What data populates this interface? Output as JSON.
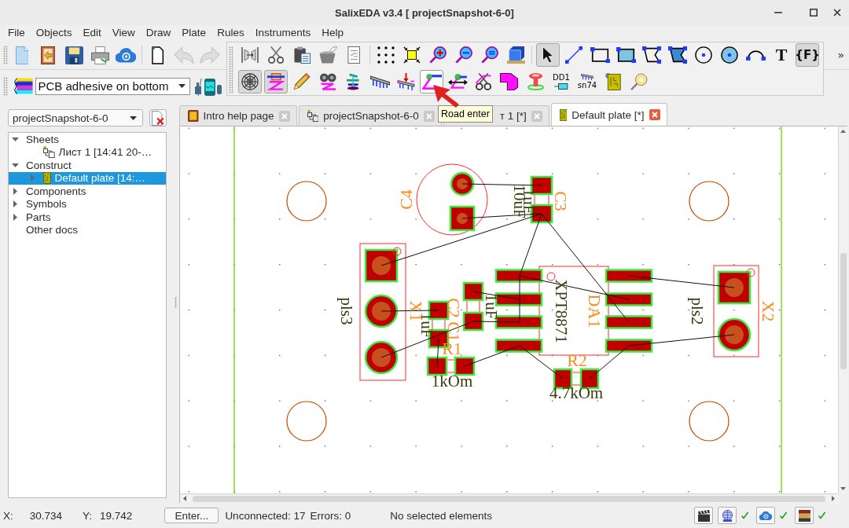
{
  "window": {
    "title": "SalixEDA v3.4 [ projectSnapshot-6-0]"
  },
  "menu": [
    "File",
    "Objects",
    "Edit",
    "View",
    "Draw",
    "Plate",
    "Rules",
    "Instruments",
    "Help"
  ],
  "main_toolbar": {
    "buttons": [
      {
        "disabled": false
      },
      {
        "disabled": false
      },
      {
        "disabled": false
      },
      {
        "disabled": false
      },
      {
        "disabled": false
      },
      {
        "disabled": false
      },
      {
        "disabled": true
      },
      {
        "disabled": true
      }
    ],
    "layer_select": {
      "value": "PCB adhesive on bottom"
    },
    "overflow": "»"
  },
  "tool_panel": {
    "row_1": [
      {
        "selected": false
      },
      {
        "selected": false
      },
      {
        "selected": false
      },
      {
        "selected": false
      },
      {
        "selected": false
      },
      {
        "selected": false
      },
      {
        "selected": false
      },
      {
        "selected": false
      },
      {
        "selected": false
      },
      {
        "selected": false
      },
      {
        "selected": false
      },
      {
        "selected": true
      },
      {
        "selected": false
      },
      {
        "selected": false
      },
      {
        "selected": false
      },
      {
        "selected": false
      },
      {
        "selected": false
      },
      {
        "selected": false
      },
      {
        "selected": false
      },
      {
        "selected": false
      },
      {
        "label": "T",
        "selected": false
      },
      {
        "label": "{F}",
        "selected": true
      }
    ],
    "row_2": [
      {
        "selected": true,
        "hovered": false
      },
      {
        "selected": true,
        "hovered": false
      },
      {
        "selected": false,
        "hovered": false
      },
      {
        "selected": false,
        "hovered": false
      },
      {
        "selected": false,
        "hovered": false
      },
      {
        "selected": false,
        "hovered": false
      },
      {
        "selected": false,
        "hovered": false
      },
      {
        "selected": false,
        "hovered": true
      },
      {
        "selected": false,
        "hovered": false
      },
      {
        "selected": false,
        "hovered": false
      },
      {
        "selected": false,
        "hovered": false
      },
      {
        "selected": false,
        "hovered": false
      },
      {
        "label": "DD1",
        "selected": false,
        "hovered": false
      },
      {
        "label": "sn74",
        "selected": false,
        "hovered": false
      },
      {
        "selected": false,
        "hovered": false
      },
      {
        "selected": false,
        "hovered": false
      }
    ]
  },
  "tooltip": {
    "text": "Road enter"
  },
  "project_select": {
    "value": "projectSnapshot-6-0"
  },
  "tree": [
    {
      "label": "Sheets",
      "expanded": true,
      "selected": false,
      "children": [
        {
          "label": "Лист 1 [14:41 20-…",
          "selected": false
        }
      ]
    },
    {
      "label": "Construct",
      "expanded": true,
      "selected": false,
      "children": [
        {
          "label": "Default plate [14:…",
          "expanded": false,
          "selected": true
        }
      ]
    },
    {
      "label": "Components",
      "expanded": false,
      "selected": false
    },
    {
      "label": "Symbols",
      "expanded": false,
      "selected": false
    },
    {
      "label": "Parts",
      "expanded": false,
      "selected": false
    },
    {
      "label": "Other docs",
      "selected": false
    }
  ],
  "tabs": [
    {
      "label": "Intro help page",
      "selected": false
    },
    {
      "label": "projectSnapshot-6-0",
      "selected": false
    },
    {
      "label": "т 1 [*]",
      "selected": false
    },
    {
      "label": "Default plate [*]",
      "selected": true
    }
  ],
  "plate": {
    "components": [
      {
        "designator": "C4",
        "value": "10uF"
      },
      {
        "designator": "C3",
        "value": "1uF"
      },
      {
        "designator": "X1",
        "value": "pls3"
      },
      {
        "designator": "C1",
        "value": "1uF"
      },
      {
        "designator": "C2",
        "value": "1uF"
      },
      {
        "designator": "R1",
        "value": "1kOm"
      },
      {
        "designator": "DA1",
        "value": "XPT8871"
      },
      {
        "designator": "R2",
        "value": "4.7kOm"
      },
      {
        "designator": "X2",
        "value": "pls2"
      }
    ]
  },
  "status_bar": {
    "x_label": "X:",
    "x_value": "30.734",
    "y_label": "Y:",
    "y_value": "19.742",
    "enter_button": "Enter...",
    "unconnected": "Unconnected: 17",
    "errors": "Errors: 0",
    "selection": "No selected elements",
    "indicators": [
      {
        "ok": false
      },
      {
        "ok": true
      },
      {
        "ok": true
      },
      {
        "ok": true
      }
    ]
  }
}
